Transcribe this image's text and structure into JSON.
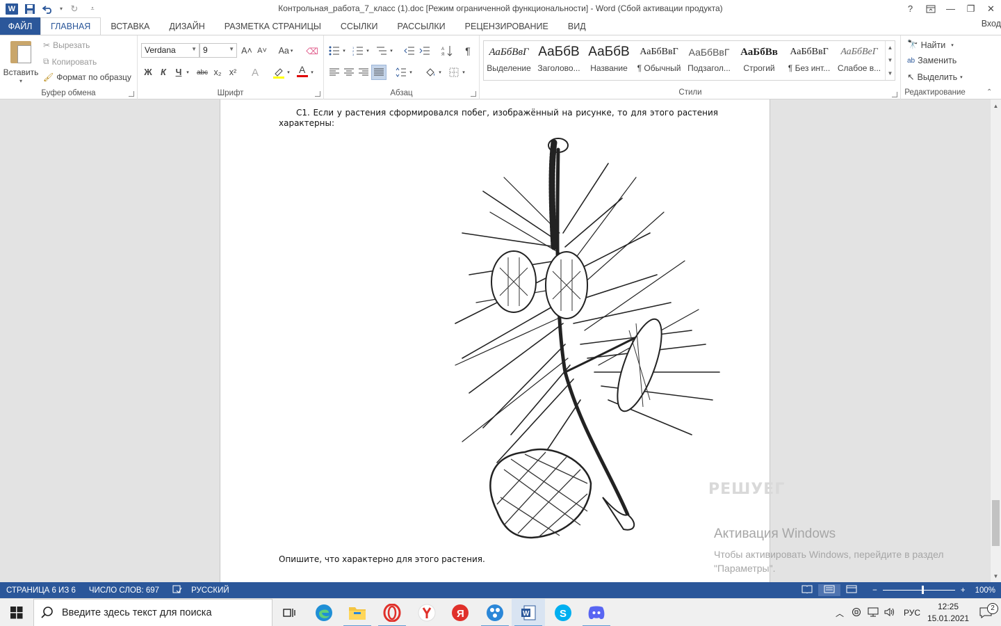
{
  "titlebar": {
    "title": "Контрольная_работа_7_класс (1).doc [Режим ограниченной функциональности] - Word (Сбой активации продукта)",
    "help": "?",
    "signin": "Вход"
  },
  "tabs": [
    "ФАЙЛ",
    "ГЛАВНАЯ",
    "ВСТАВКА",
    "ДИЗАЙН",
    "РАЗМЕТКА СТРАНИЦЫ",
    "ССЫЛКИ",
    "РАССЫЛКИ",
    "РЕЦЕНЗИРОВАНИЕ",
    "ВИД"
  ],
  "ribbon": {
    "clipboard": {
      "paste": "Вставить",
      "cut": "Вырезать",
      "copy": "Копировать",
      "format_painter": "Формат по образцу",
      "label": "Буфер обмена"
    },
    "font": {
      "name": "Verdana",
      "size": "9",
      "label": "Шрифт",
      "bold": "Ж",
      "italic": "К",
      "underline": "Ч",
      "strike": "abc",
      "subscript": "x₂",
      "superscript": "x²",
      "grow": "A˄",
      "shrink": "A˅",
      "case": "Aa"
    },
    "paragraph": {
      "label": "Абзац"
    },
    "styles": {
      "label": "Стили",
      "items": [
        {
          "sample": "АаБбВвГ",
          "name": "Выделение"
        },
        {
          "sample": "АаБбВ",
          "name": "Заголово..."
        },
        {
          "sample": "АаБбВ",
          "name": "Название"
        },
        {
          "sample": "АаБбВвГ",
          "name": "¶ Обычный"
        },
        {
          "sample": "АаБбВвГ",
          "name": "Подзагол..."
        },
        {
          "sample": "АаБбВв",
          "name": "Строгий"
        },
        {
          "sample": "АаБбВвГ",
          "name": "¶ Без инт..."
        },
        {
          "sample": "АаБбВеГ",
          "name": "Слабое в..."
        }
      ]
    },
    "editing": {
      "label": "Редактирование",
      "find": "Найти",
      "replace": "Заменить",
      "select": "Выделить"
    }
  },
  "document": {
    "question": "С1. Если у растения сформировался побег, изображённый на рисунке, то для этого растения характерны:",
    "prompt": "Опишите, что характерно для этого растения.",
    "site_watermark": "РЕШУЕГ"
  },
  "activation": {
    "title": "Активация Windows",
    "text": "Чтобы активировать Windows, перейдите в раздел \"Параметры\"."
  },
  "statusbar": {
    "page": "СТРАНИЦА 6 ИЗ 6",
    "words": "ЧИСЛО СЛОВ: 697",
    "language": "РУССКИЙ",
    "zoom": "100%"
  },
  "taskbar": {
    "search_placeholder": "Введите здесь текст для поиска",
    "language": "РУС",
    "time": "12:25",
    "date": "15.01.2021",
    "notifications": "2"
  }
}
